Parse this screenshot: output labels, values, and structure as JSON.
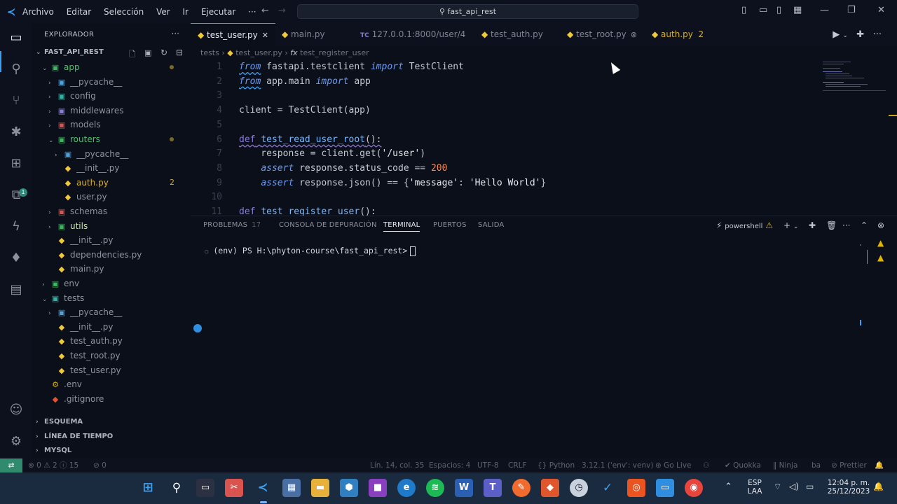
{
  "titlebar": {
    "menu": [
      "Archivo",
      "Editar",
      "Selección",
      "Ver",
      "Ir",
      "Ejecutar",
      "···"
    ],
    "search": "fast_api_rest"
  },
  "sidebar": {
    "title": "EXPLORADOR",
    "root": "FAST_API_REST",
    "items": [
      {
        "label": "app",
        "depth": 1,
        "kind": "folder-green",
        "open": true,
        "mod": true
      },
      {
        "label": "__pycache__",
        "depth": 2,
        "kind": "folder-icon",
        "open": false
      },
      {
        "label": "config",
        "depth": 2,
        "kind": "folder-teal",
        "open": false
      },
      {
        "label": "middlewares",
        "depth": 2,
        "kind": "folder-purple",
        "open": false
      },
      {
        "label": "models",
        "depth": 2,
        "kind": "folder-red",
        "open": false
      },
      {
        "label": "routers",
        "depth": 2,
        "kind": "folder-green",
        "open": true,
        "mod": true
      },
      {
        "label": "__pycache__",
        "depth": 3,
        "kind": "folder-icon",
        "open": false
      },
      {
        "label": "__init__.py",
        "depth": 3,
        "kind": "py-icon"
      },
      {
        "label": "auth.py",
        "depth": 3,
        "kind": "py-icon",
        "errors": "2",
        "highlight": true
      },
      {
        "label": "user.py",
        "depth": 3,
        "kind": "py-icon"
      },
      {
        "label": "schemas",
        "depth": 2,
        "kind": "folder-red",
        "open": false
      },
      {
        "label": "utils",
        "depth": 2,
        "kind": "folder-green",
        "open": false,
        "bright": true
      },
      {
        "label": "__init__.py",
        "depth": 2,
        "kind": "py-icon"
      },
      {
        "label": "dependencies.py",
        "depth": 2,
        "kind": "py-icon"
      },
      {
        "label": "main.py",
        "depth": 2,
        "kind": "py-icon"
      },
      {
        "label": "env",
        "depth": 1,
        "kind": "folder-green",
        "open": false
      },
      {
        "label": "tests",
        "depth": 1,
        "kind": "folder-teal",
        "open": true
      },
      {
        "label": "__pycache__",
        "depth": 2,
        "kind": "folder-icon",
        "open": false
      },
      {
        "label": "__init__.py",
        "depth": 2,
        "kind": "py-icon"
      },
      {
        "label": "test_auth.py",
        "depth": 2,
        "kind": "py-icon"
      },
      {
        "label": "test_root.py",
        "depth": 2,
        "kind": "py-icon"
      },
      {
        "label": "test_user.py",
        "depth": 2,
        "kind": "py-icon"
      },
      {
        "label": ".env",
        "depth": 1,
        "kind": "env"
      },
      {
        "label": ".gitignore",
        "depth": 1,
        "kind": "git"
      }
    ],
    "sections": [
      "ESQUEMA",
      "LÍNEA DE TIEMPO",
      "MYSQL"
    ]
  },
  "tabs": [
    {
      "label": "test_user.py",
      "active": true,
      "close": "✕"
    },
    {
      "label": "main.py"
    },
    {
      "label": "127.0.0.1:8000/user/4",
      "prefix": "TC"
    },
    {
      "label": "test_auth.py"
    },
    {
      "label": "test_root.py",
      "close": "⊗"
    },
    {
      "label": "auth.py",
      "errors": "2"
    }
  ],
  "breadcrumb": {
    "folder": "tests",
    "file": "test_user.py",
    "symbol": "test_register_user"
  },
  "code": {
    "line_numbers": [
      "1",
      "2",
      "3",
      "4",
      "5",
      "6",
      "7",
      "8",
      "9",
      "10",
      "11"
    ],
    "l1": [
      "from",
      " fastapi.testclient ",
      "import",
      " TestClient"
    ],
    "l2": [
      "from",
      " app.main ",
      "import",
      " app"
    ],
    "l4": [
      "client = TestClient(app)"
    ],
    "l6": [
      "def",
      " ",
      "test_read_user_root",
      "():"
    ],
    "l7": [
      "    response = client.get(",
      "'/user'",
      ")"
    ],
    "l8": [
      "    ",
      "assert",
      " response.status_code == ",
      "200"
    ],
    "l9": [
      "    ",
      "assert",
      " response.json() == {",
      "'message'",
      ": ",
      "'Hello World'",
      "}"
    ],
    "l11": [
      "def",
      " ",
      "test_register_user",
      "():"
    ]
  },
  "panel": {
    "tabs": [
      "PROBLEMAS",
      "CONSOLA DE DEPURACIÓN",
      "TERMINAL",
      "PUERTOS",
      "SALIDA"
    ],
    "problems_count": "17",
    "shell": "powershell",
    "prompt": "(env) PS H:\\phyton-course\\fast_api_rest>"
  },
  "status": {
    "errors": "0",
    "warnings": "2",
    "info": "15",
    "ports": "0",
    "position": "Lín. 14, col. 35",
    "spaces": "Espacios: 4",
    "encoding": "UTF-8",
    "eol": "CRLF",
    "language": "Python",
    "interpreter": "3.12.1 ('env': venv)",
    "golive": "Go Live",
    "quokka": "Quokka",
    "ninja": "Ninja",
    "ba": "ba",
    "prettier": "Prettier"
  },
  "taskbar": {
    "lang": "ESP",
    "region": "LAA",
    "time": "12:04 p. m.",
    "date": "25/12/2023"
  }
}
